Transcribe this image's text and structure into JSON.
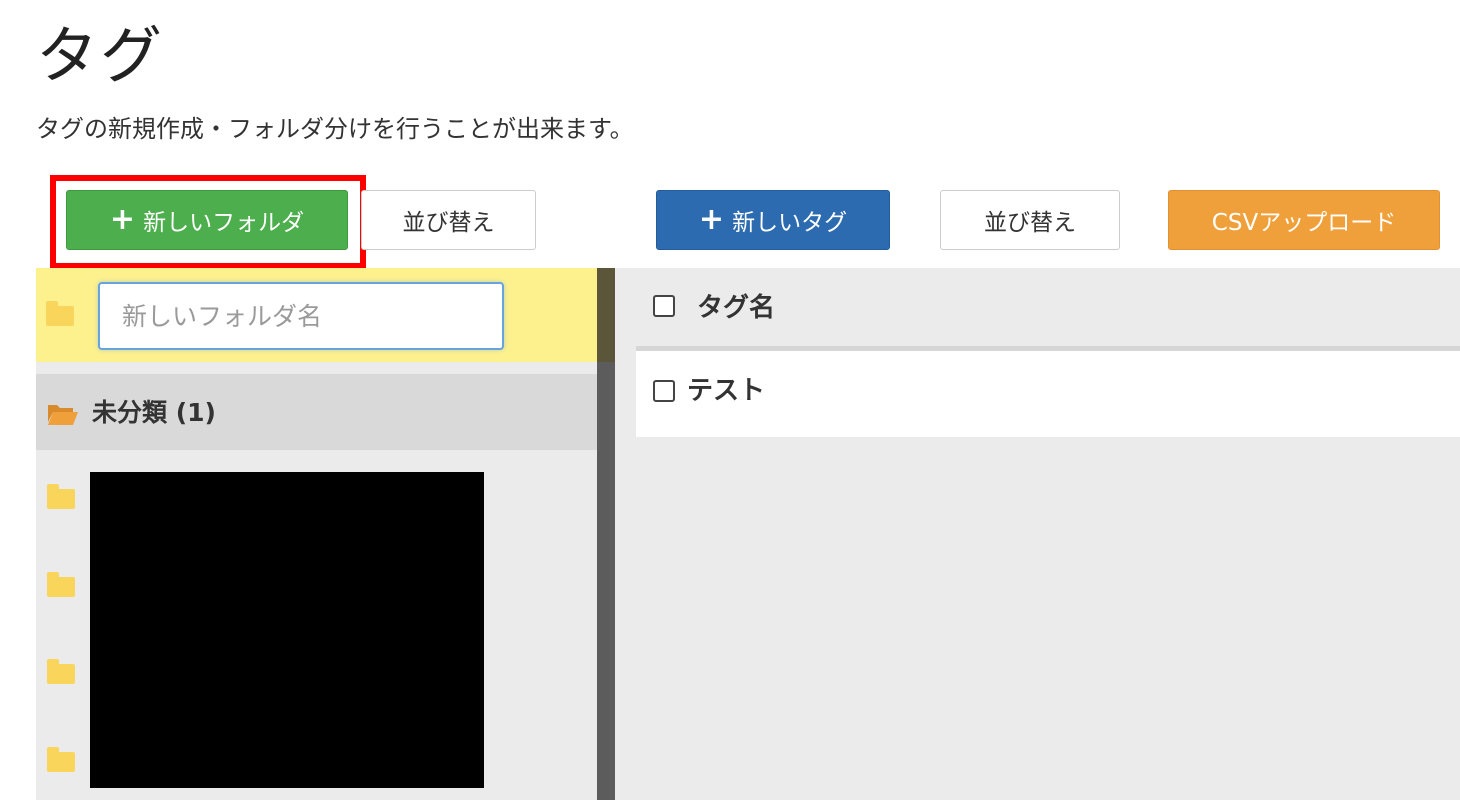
{
  "page": {
    "title": "タグ",
    "description": "タグの新規作成・フォルダ分けを行うことが出来ます。"
  },
  "toolbar": {
    "new_folder_label": "新しいフォルダ",
    "sort_folders_label": "並び替え",
    "new_tag_label": "新しいタグ",
    "sort_tags_label": "並び替え",
    "csv_upload_label": "CSVアップロード",
    "plus_glyph": "+"
  },
  "folders": {
    "new_folder_placeholder": "新しいフォルダ名",
    "new_folder_value": "",
    "unclassified_label": "未分類 (1)",
    "redacted_folder_count": 4,
    "icons": {
      "folder": "folder-icon",
      "open_folder": "folder-open-icon"
    }
  },
  "tags": {
    "header_label": "タグ名",
    "rows": [
      {
        "name": "テスト",
        "checked": false
      }
    ]
  },
  "colors": {
    "new_folder_button": "#4cae4c",
    "new_tag_button": "#2c6bb0",
    "csv_button": "#f0a03a",
    "highlight_box": "#ff0000",
    "new_folder_row": "#fdf18e",
    "folder_icon": "#f9d55c",
    "open_folder_icon": "#f0a03a"
  }
}
